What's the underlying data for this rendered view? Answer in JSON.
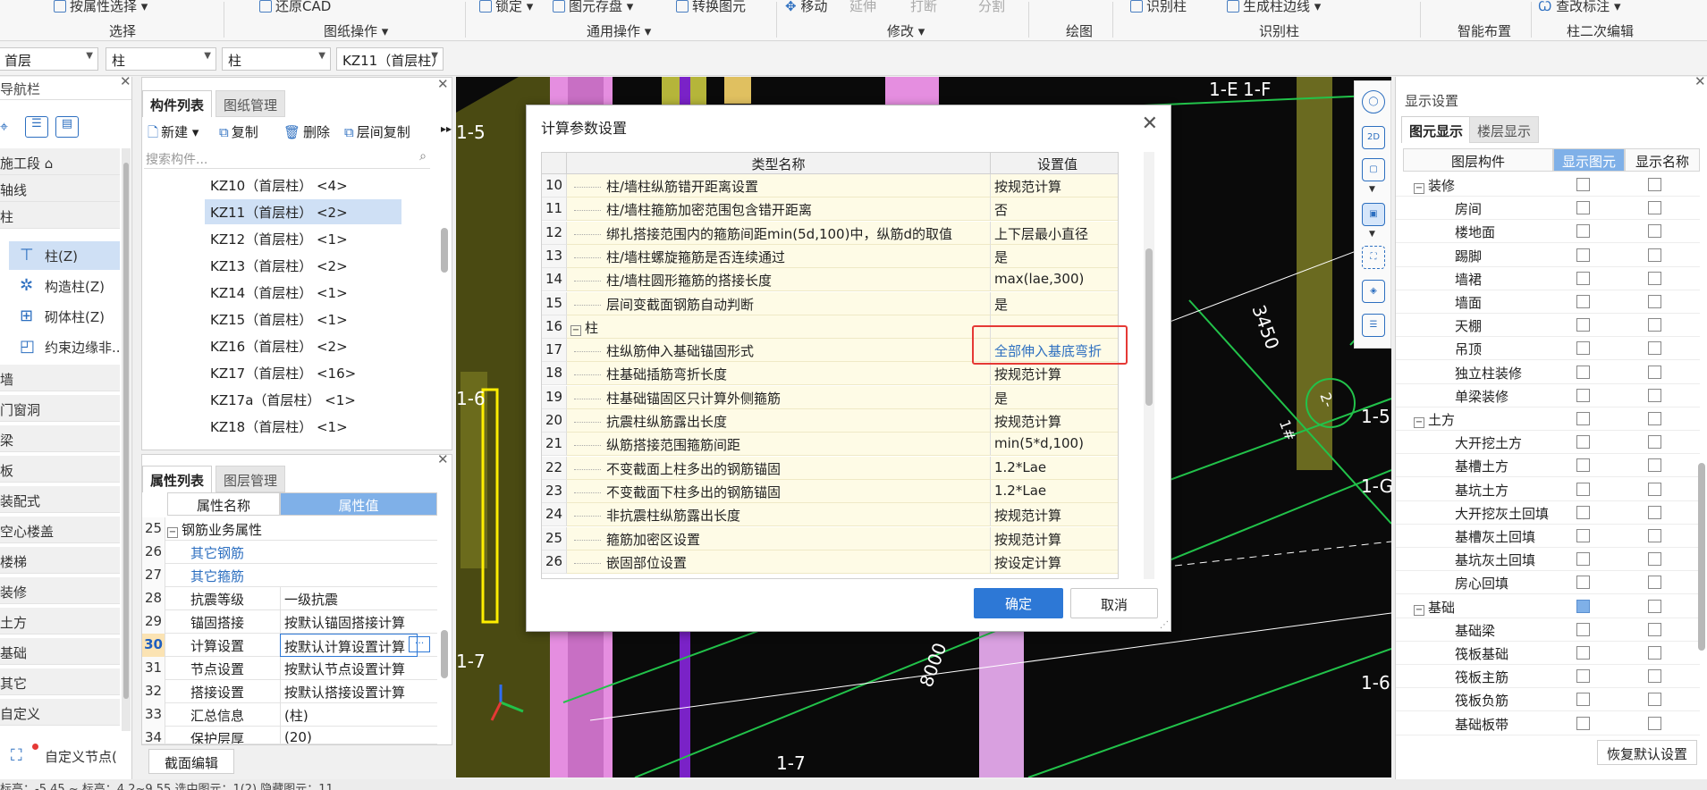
{
  "ribbon": {
    "items": [
      "按属性选择",
      "还原CAD",
      "锁定",
      "图元存盘",
      "转换图元",
      "移动",
      "延伸",
      "打断",
      "分割",
      "识别柱",
      "生成柱边线",
      "查改标注"
    ],
    "groups": [
      "选择",
      "图纸操作",
      "通用操作",
      "修改",
      "绘图",
      "识别柱",
      "智能布置",
      "柱二次编辑"
    ]
  },
  "selectors": [
    "首层",
    "柱",
    "柱",
    "KZ11（首层柱）"
  ],
  "nav": {
    "title": "导航栏",
    "items": [
      "施工段",
      "轴线",
      "柱",
      "墙",
      "门窗洞",
      "梁",
      "板",
      "装配式",
      "空心楼盖",
      "楼梯",
      "装修",
      "土方",
      "基础",
      "其它",
      "自定义"
    ],
    "sub_items": [
      "柱(Z)",
      "构造柱(Z)",
      "砌体柱(Z)",
      "约束边缘非..."
    ],
    "custom_node": "自定义节点("
  },
  "component_list": {
    "tabs": [
      "构件列表",
      "图纸管理"
    ],
    "tools": [
      "新建",
      "复制",
      "删除",
      "层间复制"
    ],
    "search_placeholder": "搜索构件...",
    "rows": [
      "KZ10（首层柱） <4>",
      "KZ11（首层柱） <2>",
      "KZ12（首层柱） <1>",
      "KZ13（首层柱） <2>",
      "KZ14（首层柱） <1>",
      "KZ15（首层柱） <1>",
      "KZ16（首层柱） <2>",
      "KZ17（首层柱） <16>",
      "KZ17a（首层柱） <1>",
      "KZ18（首层柱） <1>"
    ]
  },
  "attributes": {
    "tabs": [
      "属性列表",
      "图层管理"
    ],
    "headers": [
      "属性名称",
      "属性值"
    ],
    "rows": [
      {
        "num": "25",
        "name": "钢筋业务属性",
        "value": ""
      },
      {
        "num": "26",
        "name": "其它钢筋",
        "value": ""
      },
      {
        "num": "27",
        "name": "其它箍筋",
        "value": ""
      },
      {
        "num": "28",
        "name": "抗震等级",
        "value": "一级抗震"
      },
      {
        "num": "29",
        "name": "锚固搭接",
        "value": "按默认锚固搭接计算"
      },
      {
        "num": "30",
        "name": "计算设置",
        "value": "按默认计算设置计算"
      },
      {
        "num": "31",
        "name": "节点设置",
        "value": "按默认节点设置计算"
      },
      {
        "num": "32",
        "name": "搭接设置",
        "value": "按默认搭接设置计算"
      },
      {
        "num": "33",
        "name": "汇总信息",
        "value": "(柱)"
      },
      {
        "num": "34",
        "name": "保护层厚",
        "value": "(20)"
      }
    ],
    "section_button": "截面编辑"
  },
  "canvas": {
    "labels": [
      "1-E",
      "1-F",
      "1-5",
      "1-6",
      "1-7",
      "1-5",
      "1-G",
      "1-6",
      "1-7",
      "3450",
      "8000",
      "1#",
      "2-"
    ]
  },
  "dialog": {
    "title": "计算参数设置",
    "headers": [
      "类型名称",
      "设置值"
    ],
    "rows": [
      {
        "num": "10",
        "name": "柱/墙柱纵筋错开距离设置",
        "value": "按规范计算"
      },
      {
        "num": "11",
        "name": "柱/墙柱箍筋加密范围包含错开距离",
        "value": "否"
      },
      {
        "num": "12",
        "name": "绑扎搭接范围内的箍筋间距min(5d,100)中，纵筋d的取值",
        "value": "上下层最小直径"
      },
      {
        "num": "13",
        "name": "柱/墙柱螺旋箍筋是否连续通过",
        "value": "是"
      },
      {
        "num": "14",
        "name": "柱/墙柱圆形箍筋的搭接长度",
        "value": "max(lae,300)"
      },
      {
        "num": "15",
        "name": "层间变截面钢筋自动判断",
        "value": "是"
      },
      {
        "num": "16",
        "name": "柱",
        "value": ""
      },
      {
        "num": "17",
        "name": "柱纵筋伸入基础锚固形式",
        "value": "全部伸入基底弯折"
      },
      {
        "num": "18",
        "name": "柱基础插筋弯折长度",
        "value": "按规范计算"
      },
      {
        "num": "19",
        "name": "柱基础锚固区只计算外侧箍筋",
        "value": "是"
      },
      {
        "num": "20",
        "name": "抗震柱纵筋露出长度",
        "value": "按规范计算"
      },
      {
        "num": "21",
        "name": "纵筋搭接范围箍筋间距",
        "value": "min(5*d,100)"
      },
      {
        "num": "22",
        "name": "不变截面上柱多出的钢筋锚固",
        "value": "1.2*Lae"
      },
      {
        "num": "23",
        "name": "不变截面下柱多出的钢筋锚固",
        "value": "1.2*Lae"
      },
      {
        "num": "24",
        "name": "非抗震柱纵筋露出长度",
        "value": "按规范计算"
      },
      {
        "num": "25",
        "name": "箍筋加密区设置",
        "value": "按规范计算"
      },
      {
        "num": "26",
        "name": "嵌固部位设置",
        "value": "按设定计算"
      }
    ],
    "ok": "确定",
    "cancel": "取消"
  },
  "display_settings": {
    "title": "显示设置",
    "tabs": [
      "图元显示",
      "楼层显示"
    ],
    "headers": [
      "图层构件",
      "显示图元",
      "显示名称"
    ],
    "rows": [
      {
        "label": "装修",
        "group": true,
        "checked": false
      },
      {
        "label": "房间",
        "group": false,
        "checked": false
      },
      {
        "label": "楼地面",
        "group": false,
        "checked": false
      },
      {
        "label": "踢脚",
        "group": false,
        "checked": false
      },
      {
        "label": "墙裙",
        "group": false,
        "checked": false
      },
      {
        "label": "墙面",
        "group": false,
        "checked": false
      },
      {
        "label": "天棚",
        "group": false,
        "checked": false
      },
      {
        "label": "吊顶",
        "group": false,
        "checked": false
      },
      {
        "label": "独立柱装修",
        "group": false,
        "checked": false
      },
      {
        "label": "单梁装修",
        "group": false,
        "checked": false
      },
      {
        "label": "土方",
        "group": true,
        "checked": false
      },
      {
        "label": "大开挖土方",
        "group": false,
        "checked": false
      },
      {
        "label": "基槽土方",
        "group": false,
        "checked": false
      },
      {
        "label": "基坑土方",
        "group": false,
        "checked": false
      },
      {
        "label": "大开挖灰土回填",
        "group": false,
        "checked": false
      },
      {
        "label": "基槽灰土回填",
        "group": false,
        "checked": false
      },
      {
        "label": "基坑灰土回填",
        "group": false,
        "checked": false
      },
      {
        "label": "房心回填",
        "group": false,
        "checked": false
      },
      {
        "label": "基础",
        "group": true,
        "checked": true
      },
      {
        "label": "基础梁",
        "group": false,
        "checked": false
      },
      {
        "label": "筏板基础",
        "group": false,
        "checked": false
      },
      {
        "label": "筏板主筋",
        "group": false,
        "checked": false
      },
      {
        "label": "筏板负筋",
        "group": false,
        "checked": false
      },
      {
        "label": "基础板带",
        "group": false,
        "checked": false
      }
    ],
    "restore": "恢复默认设置"
  },
  "status_bar": "标高：-5.45 ~ 标高：4.2~9.55     选中图元：1(2)     隐藏图元：11"
}
